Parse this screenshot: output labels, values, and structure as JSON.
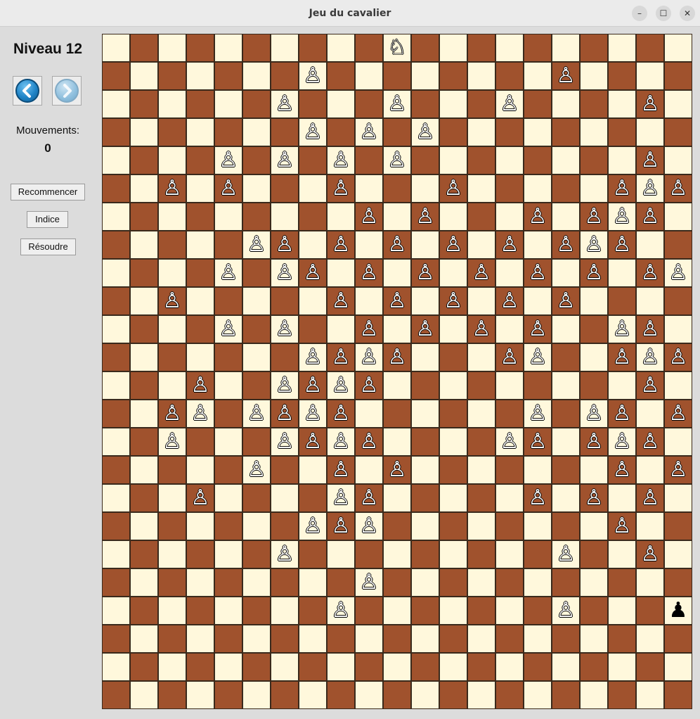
{
  "window": {
    "title": "Jeu du cavalier",
    "controls": [
      "–",
      "☐",
      "✕"
    ]
  },
  "sidebar": {
    "level_label": "Niveau 12",
    "prev_icon": "chevron-left-icon",
    "next_icon": "chevron-right-icon",
    "moves_label": "Mouvements:",
    "moves_value": "0",
    "restart_label": "Recommencer",
    "hint_label": "Indice",
    "solve_label": "Résoudre"
  },
  "board": {
    "cols": 21,
    "rows": 24,
    "light_color": "#fff8dc",
    "dark_color": "#a0522d",
    "knight": [
      0,
      10
    ],
    "black_pawn": [
      20,
      20
    ],
    "white_pawns": [
      [
        1,
        7
      ],
      [
        1,
        16
      ],
      [
        2,
        6
      ],
      [
        2,
        10
      ],
      [
        2,
        14
      ],
      [
        2,
        19
      ],
      [
        3,
        7
      ],
      [
        3,
        9
      ],
      [
        3,
        11
      ],
      [
        4,
        4
      ],
      [
        4,
        6
      ],
      [
        4,
        8
      ],
      [
        4,
        10
      ],
      [
        4,
        19
      ],
      [
        5,
        2
      ],
      [
        5,
        4
      ],
      [
        5,
        8
      ],
      [
        5,
        12
      ],
      [
        5,
        18
      ],
      [
        5,
        19
      ],
      [
        5,
        20
      ],
      [
        6,
        9
      ],
      [
        6,
        11
      ],
      [
        6,
        15
      ],
      [
        6,
        17
      ],
      [
        6,
        18
      ],
      [
        6,
        19
      ],
      [
        7,
        5
      ],
      [
        7,
        6
      ],
      [
        7,
        8
      ],
      [
        7,
        10
      ],
      [
        7,
        12
      ],
      [
        7,
        14
      ],
      [
        7,
        16
      ],
      [
        7,
        17
      ],
      [
        7,
        18
      ],
      [
        8,
        4
      ],
      [
        8,
        6
      ],
      [
        8,
        7
      ],
      [
        8,
        9
      ],
      [
        8,
        11
      ],
      [
        8,
        13
      ],
      [
        8,
        15
      ],
      [
        8,
        17
      ],
      [
        8,
        19
      ],
      [
        8,
        20
      ],
      [
        9,
        2
      ],
      [
        9,
        8
      ],
      [
        9,
        10
      ],
      [
        9,
        12
      ],
      [
        9,
        14
      ],
      [
        9,
        16
      ],
      [
        10,
        4
      ],
      [
        10,
        6
      ],
      [
        10,
        9
      ],
      [
        10,
        11
      ],
      [
        10,
        13
      ],
      [
        10,
        15
      ],
      [
        10,
        18
      ],
      [
        10,
        19
      ],
      [
        11,
        7
      ],
      [
        11,
        8
      ],
      [
        11,
        9
      ],
      [
        11,
        10
      ],
      [
        11,
        14
      ],
      [
        11,
        15
      ],
      [
        11,
        18
      ],
      [
        11,
        19
      ],
      [
        11,
        20
      ],
      [
        12,
        3
      ],
      [
        12,
        6
      ],
      [
        12,
        7
      ],
      [
        12,
        8
      ],
      [
        12,
        9
      ],
      [
        12,
        19
      ],
      [
        13,
        2
      ],
      [
        13,
        3
      ],
      [
        13,
        5
      ],
      [
        13,
        6
      ],
      [
        13,
        7
      ],
      [
        13,
        8
      ],
      [
        13,
        15
      ],
      [
        13,
        17
      ],
      [
        13,
        18
      ],
      [
        13,
        20
      ],
      [
        14,
        2
      ],
      [
        14,
        6
      ],
      [
        14,
        7
      ],
      [
        14,
        8
      ],
      [
        14,
        9
      ],
      [
        14,
        14
      ],
      [
        14,
        15
      ],
      [
        14,
        17
      ],
      [
        14,
        18
      ],
      [
        14,
        19
      ],
      [
        15,
        5
      ],
      [
        15,
        8
      ],
      [
        15,
        10
      ],
      [
        15,
        18
      ],
      [
        15,
        20
      ],
      [
        16,
        3
      ],
      [
        16,
        8
      ],
      [
        16,
        9
      ],
      [
        16,
        15
      ],
      [
        16,
        17
      ],
      [
        16,
        19
      ],
      [
        17,
        7
      ],
      [
        17,
        8
      ],
      [
        17,
        9
      ],
      [
        17,
        18
      ],
      [
        18,
        6
      ],
      [
        18,
        16
      ],
      [
        18,
        19
      ],
      [
        19,
        9
      ],
      [
        20,
        8
      ],
      [
        20,
        16
      ]
    ]
  }
}
